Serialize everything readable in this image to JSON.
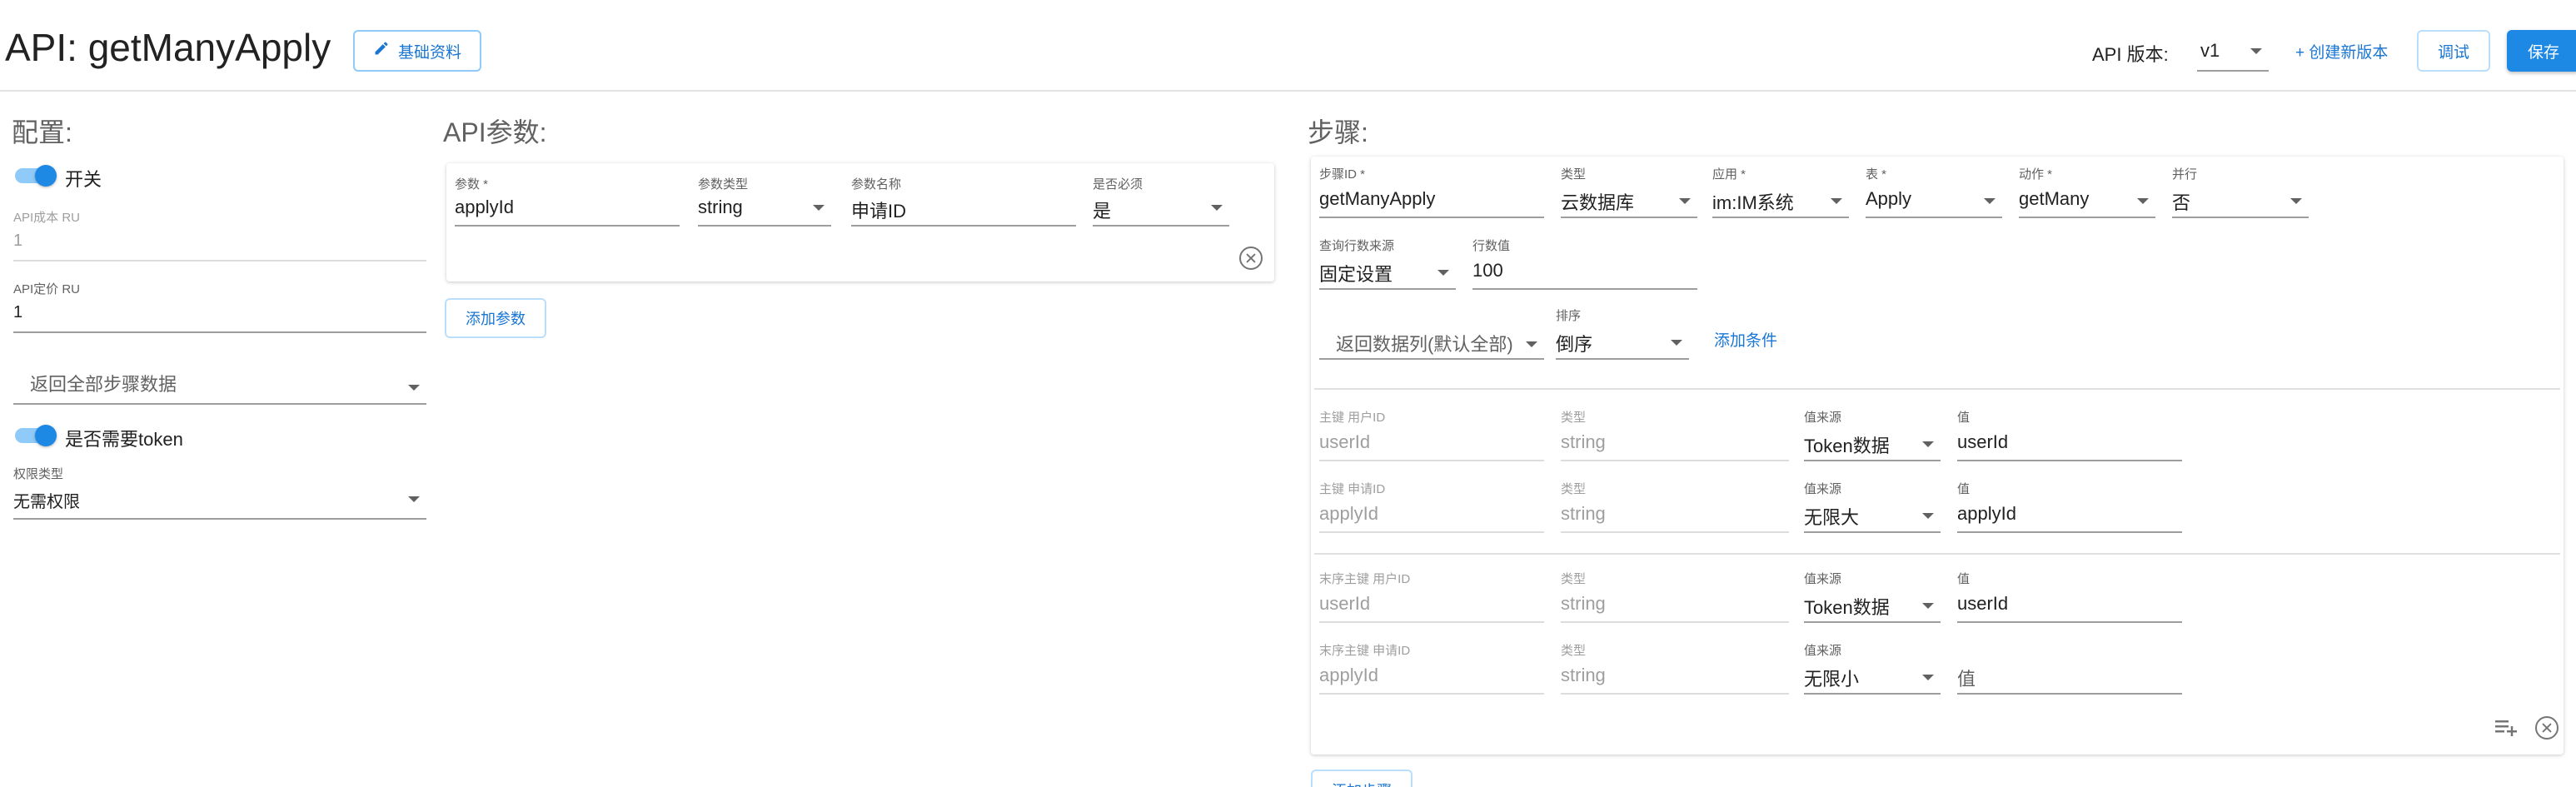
{
  "header": {
    "title": "API: getManyApply",
    "basic_info_button": "基础资料",
    "version_label": "API 版本:",
    "version_value": "v1",
    "create_version_link": "+ 创建新版本",
    "debug_button": "调试",
    "save_button": "保存"
  },
  "config": {
    "title": "配置:",
    "switch_label": "开关",
    "api_cost_label": "API成本 RU",
    "api_cost_value": "1",
    "api_price_label": "API定价 RU",
    "api_price_value": "1",
    "return_data_placeholder": "返回全部步骤数据",
    "token_label": "是否需要token",
    "permission_type_label": "权限类型",
    "permission_type_value": "无需权限"
  },
  "params": {
    "title": "API参数:",
    "row": {
      "param_label": "参数 *",
      "param_value": "applyId",
      "type_label": "参数类型",
      "type_value": "string",
      "name_label": "参数名称",
      "name_value": "申请ID",
      "required_label": "是否必须",
      "required_value": "是"
    },
    "add_button": "添加参数"
  },
  "steps": {
    "title": "步骤:",
    "step_id_label": "步骤ID *",
    "step_id_value": "getManyApply",
    "type_label": "类型",
    "type_value": "云数据库",
    "app_label": "应用 *",
    "app_value": "im:IM系统",
    "table_label": "表 *",
    "table_value": "Apply",
    "action_label": "动作 *",
    "action_value": "getMany",
    "parallel_label": "并行",
    "parallel_value": "否",
    "row_source_label": "查询行数来源",
    "row_source_value": "固定设置",
    "row_count_label": "行数值",
    "row_count_value": "100",
    "return_columns_placeholder": "返回数据列(默认全部)",
    "sort_label": "排序",
    "sort_value": "倒序",
    "add_condition_link": "添加条件",
    "key_rows": [
      {
        "key_label": "主键  用户ID",
        "key_value": "userId",
        "type_label": "类型",
        "type_value": "string",
        "source_label": "值来源",
        "source_value": "Token数据",
        "value_label": "值",
        "value_value": "userId"
      },
      {
        "key_label": "主键  申请ID",
        "key_value": "applyId",
        "type_label": "类型",
        "type_value": "string",
        "source_label": "值来源",
        "source_value": "无限大",
        "value_label": "值",
        "value_value": "applyId"
      },
      {
        "key_label": "末序主键  用户ID",
        "key_value": "userId",
        "type_label": "类型",
        "type_value": "string",
        "source_label": "值来源",
        "source_value": "Token数据",
        "value_label": "值",
        "value_value": "userId"
      },
      {
        "key_label": "末序主键  申请ID",
        "key_value": "applyId",
        "type_label": "类型",
        "type_value": "string",
        "source_label": "值来源",
        "source_value": "无限小",
        "value_label": "",
        "value_value": "值"
      }
    ],
    "add_step_button": "添加步骤"
  },
  "colors": {
    "primary": "#1e88e5",
    "toggle_track": "#90caf9",
    "outline": "#90caf9"
  }
}
